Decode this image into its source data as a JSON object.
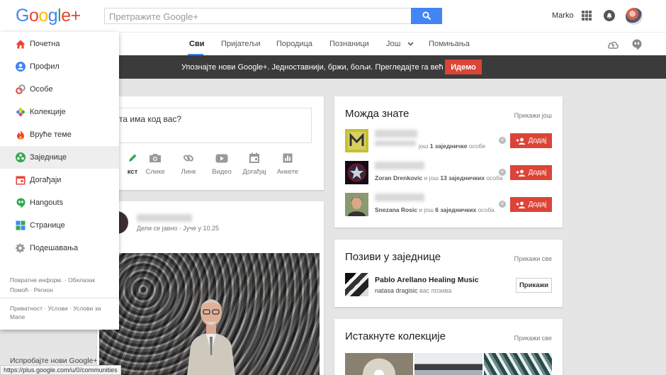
{
  "colors": {
    "brand_blue": "#4285f4",
    "accent_red": "#db4437",
    "promo_bg": "#3b3b3b"
  },
  "header": {
    "logo": [
      "G",
      "o",
      "o",
      "g",
      "l",
      "e",
      "+"
    ],
    "search_placeholder": "Претражите Google+",
    "user_name": "Marko"
  },
  "tabs": [
    "Сви",
    "Пријатељи",
    "Породица",
    "Познаници",
    "Још",
    "Помињања"
  ],
  "promo": {
    "text": "Упознајте нови Google+.  Једноставнији, бржи, бољи. Прегледајте га већ данас.",
    "button": "Идемо"
  },
  "sidebar": {
    "items": [
      {
        "label": "Почетна",
        "icon": "home-icon"
      },
      {
        "label": "Профил",
        "icon": "profile-icon"
      },
      {
        "label": "Особе",
        "icon": "people-icon"
      },
      {
        "label": "Колекције",
        "icon": "collections-icon"
      },
      {
        "label": "Вруће теме",
        "icon": "hot-icon"
      },
      {
        "label": "Заједнице",
        "icon": "communities-icon"
      },
      {
        "label": "Догађаји",
        "icon": "events-icon"
      },
      {
        "label": "Hangouts",
        "icon": "hangouts-icon"
      },
      {
        "label": "Странице",
        "icon": "pages-icon"
      },
      {
        "label": "Подешавања",
        "icon": "settings-icon"
      }
    ],
    "footer1": "Повратне информ. · Обилазак",
    "footer2": "Помоћ · Регион",
    "footer3": "Приватност · Услови · Услови за",
    "footer4": "Мапе",
    "try_new": "Испробајте нови Google+",
    "status_url": "https://plus.google.com/u/0/communities"
  },
  "compose": {
    "prompt": "та има код вас?",
    "actions": [
      "кст",
      "Слике",
      "Линк",
      "Видео",
      "Догађај",
      "Анкете"
    ]
  },
  "post": {
    "meta": "Дели се јавно  ·  Јуче у 10.25"
  },
  "suggestions": {
    "title": "Можда знате",
    "link": "Прикажи још",
    "add_label": "Додај",
    "rows": [
      {
        "name": "",
        "pre": "",
        "count": "1 заједничке",
        "post": " особе"
      },
      {
        "name": "Zoran Drenkovic",
        "pre": " и још ",
        "count": "13 заједничких",
        "post": " особа"
      },
      {
        "name": "Snezana Rosic",
        "pre": " и још ",
        "count": "6 заједничких",
        "post": " особа"
      }
    ],
    "row1_prefix": "још "
  },
  "invites": {
    "title": "Позиви у заједнице",
    "link": "Прикажи све",
    "name": "Pablo Arellano Healing Music",
    "inviter": "natasa dragisic",
    "inviter_suffix": " вас позива",
    "view_button": "Прикажи"
  },
  "collections": {
    "title": "Истакнуте колекције",
    "link": "Прикажи све"
  }
}
